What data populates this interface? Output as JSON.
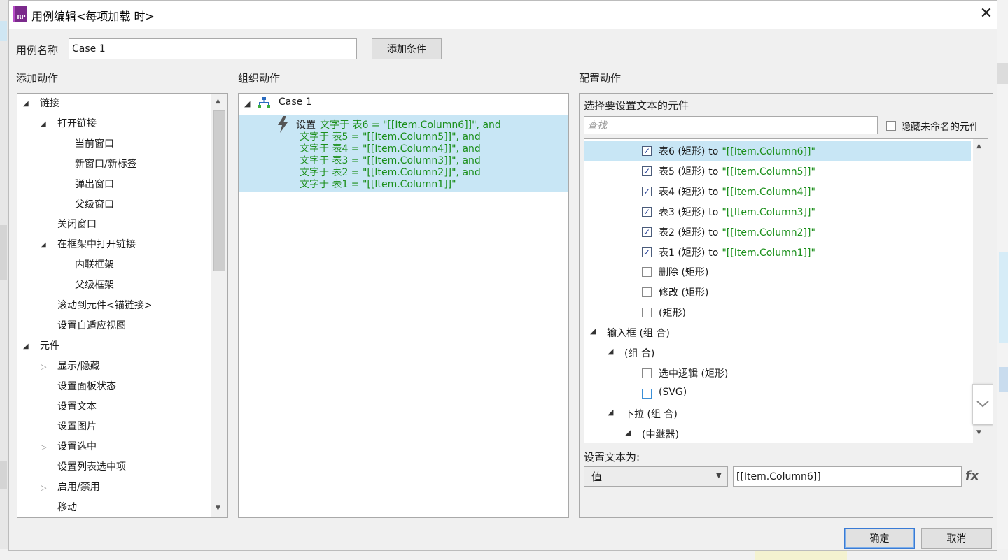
{
  "window": {
    "title": "用例编辑<每项加载 时>",
    "app_badge": "RP"
  },
  "case_name": {
    "label": "用例名称",
    "value": "Case 1",
    "add_condition_button": "添加条件"
  },
  "panels": {
    "add_action": "添加动作",
    "organize_action": "组织动作",
    "configure_action": "配置动作"
  },
  "add_action_tree": [
    {
      "label": "链接",
      "expander": "open"
    },
    {
      "label": "打开链接",
      "expander": "open"
    },
    {
      "label": "当前窗口",
      "expander": "none"
    },
    {
      "label": "新窗口/新标签",
      "expander": "none"
    },
    {
      "label": "弹出窗口",
      "expander": "none"
    },
    {
      "label": "父级窗口",
      "expander": "none"
    },
    {
      "label": "关闭窗口",
      "expander": "none"
    },
    {
      "label": "在框架中打开链接",
      "expander": "open"
    },
    {
      "label": "内联框架",
      "expander": "none"
    },
    {
      "label": "父级框架",
      "expander": "none"
    },
    {
      "label": "滚动到元件<锚链接>",
      "expander": "none"
    },
    {
      "label": "设置自适应视图",
      "expander": "none"
    },
    {
      "label": "元件",
      "expander": "open"
    },
    {
      "label": "显示/隐藏",
      "expander": "closed"
    },
    {
      "label": "设置面板状态",
      "expander": "none"
    },
    {
      "label": "设置文本",
      "expander": "none"
    },
    {
      "label": "设置图片",
      "expander": "none"
    },
    {
      "label": "设置选中",
      "expander": "closed"
    },
    {
      "label": "设置列表选中项",
      "expander": "none"
    },
    {
      "label": "启用/禁用",
      "expander": "closed"
    },
    {
      "label": "移动",
      "expander": "none"
    }
  ],
  "organize": {
    "case_label": "Case 1",
    "action_prefix": "设置",
    "action_lines": [
      "文字于 表6 = \"[[Item.Column6]]\", and",
      "文字于 表5 = \"[[Item.Column5]]\", and",
      "文字于 表4 = \"[[Item.Column4]]\", and",
      "文字于 表3 = \"[[Item.Column3]]\", and",
      "文字于 表2 = \"[[Item.Column2]]\", and",
      "文字于 表1 = \"[[Item.Column1]]\""
    ]
  },
  "configure": {
    "heading": "选择要设置文本的元件",
    "search_placeholder": "查找",
    "hide_unnamed_label": "隐藏未命名的元件",
    "widgets": [
      {
        "name": "表6 (矩形)",
        "value": "\"[[Item.Column6]]\"",
        "checked": true
      },
      {
        "name": "表5 (矩形)",
        "value": "\"[[Item.Column5]]\"",
        "checked": true
      },
      {
        "name": "表4 (矩形)",
        "value": "\"[[Item.Column4]]\"",
        "checked": true
      },
      {
        "name": "表3 (矩形)",
        "value": "\"[[Item.Column3]]\"",
        "checked": true
      },
      {
        "name": "表2 (矩形)",
        "value": "\"[[Item.Column2]]\"",
        "checked": true
      },
      {
        "name": "表1 (矩形)",
        "value": "\"[[Item.Column1]]\"",
        "checked": true
      },
      {
        "name": "删除 (矩形)",
        "value": "",
        "checked": false
      },
      {
        "name": "修改 (矩形)",
        "value": "",
        "checked": false
      },
      {
        "name": "(矩形)",
        "value": "",
        "checked": false
      }
    ],
    "groups": [
      {
        "label": "输入框 (组 合)"
      },
      {
        "label": "(组 合)"
      },
      {
        "label": "选中逻辑 (矩形)"
      },
      {
        "label": "(SVG)"
      },
      {
        "label": "下拉 (组 合)"
      },
      {
        "label": "(中继器)"
      }
    ],
    "to_word": "to",
    "set_text_label": "设置文本为:",
    "type_select_value": "值",
    "text_value": "[[Item.Column6]]",
    "fx_label": "fx"
  },
  "footer": {
    "ok": "确定",
    "cancel": "取消"
  }
}
